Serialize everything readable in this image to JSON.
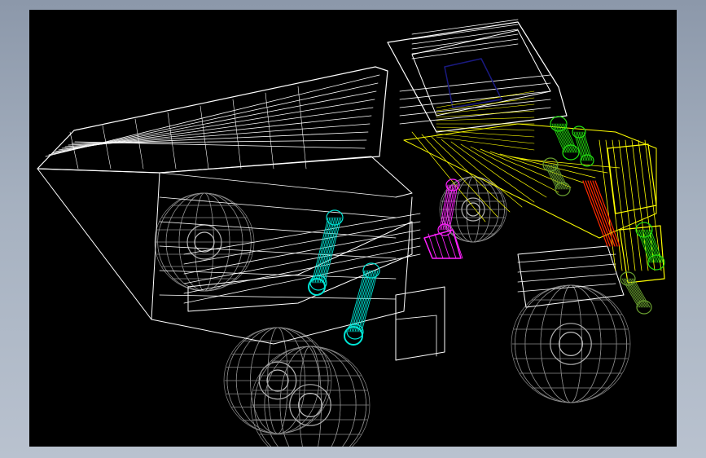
{
  "viewport": {
    "background": "#000000",
    "subject": "dump-truck-wireframe"
  },
  "colors": {
    "frame_gradient_top": "#8c98aa",
    "frame_gradient_bottom": "#b9c2cf",
    "body_wire": "#ffffff",
    "wheel_wire": "#8a8a8a",
    "cab_wire": "#ffff00",
    "hydraulic_cyan": "#00e5d5",
    "hydraulic_green": "#22e010",
    "magenta_part": "#ff20ff",
    "red_part": "#ff2a00",
    "dark_blue_panel": "#1a1a80",
    "olive_part": "#6aa030"
  }
}
